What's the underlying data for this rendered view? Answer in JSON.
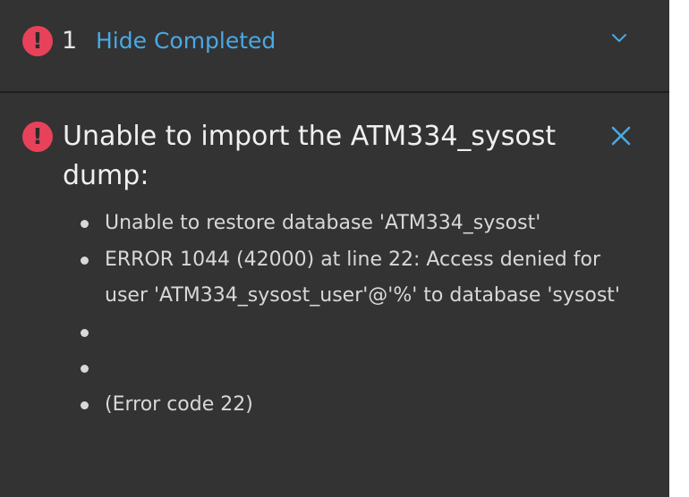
{
  "header": {
    "count": "1",
    "toggle_label": "Hide Completed",
    "error_icon": "error-circle-icon",
    "chevron_icon": "chevron-down-icon"
  },
  "message": {
    "title": "Unable to import the ATM334_sysost dump:",
    "close_icon": "close-icon",
    "details": [
      "Unable to restore database 'ATM334_sysost'",
      "ERROR 1044 (42000) at line 22: Access denied for user 'ATM334_sysost_user'@'%' to database 'sysost'",
      "",
      "",
      "(Error code 22)"
    ]
  },
  "colors": {
    "panel_background": "#333333",
    "error_red": "#e8425a",
    "link_blue": "#4aa8e6",
    "text": "#d8d8d8"
  }
}
